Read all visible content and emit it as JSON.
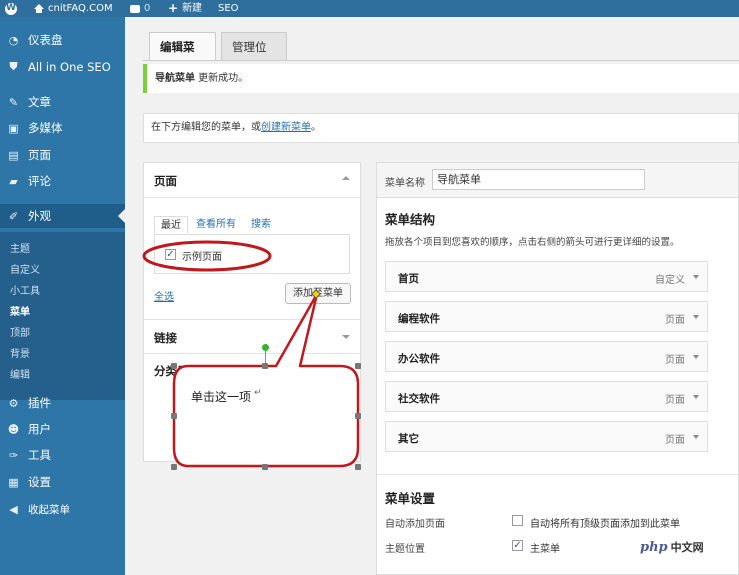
{
  "adminbar": {
    "site_name": "cnitFAQ.COM",
    "comments_count": "0",
    "new_label": "新建",
    "seo_label": "SEO"
  },
  "sidebar": {
    "items": [
      {
        "label": "仪表盘",
        "icon": "dashboard-icon"
      },
      {
        "label": "All in One SEO",
        "icon": "shield-icon"
      },
      {
        "label": "文章",
        "icon": "pin-icon"
      },
      {
        "label": "多媒体",
        "icon": "media-icon"
      },
      {
        "label": "页面",
        "icon": "page-icon"
      },
      {
        "label": "评论",
        "icon": "comment-icon"
      },
      {
        "label": "外观",
        "icon": "appearance-icon"
      },
      {
        "label": "插件",
        "icon": "plugin-icon"
      },
      {
        "label": "用户",
        "icon": "user-icon"
      },
      {
        "label": "工具",
        "icon": "wrench-icon"
      },
      {
        "label": "设置",
        "icon": "settings-icon"
      },
      {
        "label": "收起菜单",
        "icon": "collapse-icon"
      }
    ],
    "submenu": [
      "主题",
      "自定义",
      "小工具",
      "菜单",
      "顶部",
      "背景",
      "编辑"
    ],
    "current_sub": "菜单"
  },
  "tabs": {
    "edit": "编辑菜单",
    "manage": "管理位置"
  },
  "notice": {
    "strong": "导航菜单",
    "text": " 更新成功。"
  },
  "manage_box": {
    "prefix": "在下方编辑您的菜单，或",
    "link": "创建新菜单",
    "suffix": "。"
  },
  "left_panel": {
    "title": "页面",
    "subtabs": [
      "最近",
      "查看所有",
      "搜索"
    ],
    "page_item": "示例页面",
    "page_item_checked": true,
    "select_all": "全选",
    "add_button": "添加至菜单",
    "links_title": "链接",
    "categories_title": "分类目录"
  },
  "right_panel": {
    "name_label": "菜单名称",
    "name_value": "导航菜单",
    "structure_title": "菜单结构",
    "structure_hint": "拖放各个项目到您喜欢的顺序，点击右侧的箭头可进行更详细的设置。",
    "menu_items": [
      {
        "title": "首页",
        "type": "自定义"
      },
      {
        "title": "编程软件",
        "type": "页面"
      },
      {
        "title": "办公软件",
        "type": "页面"
      },
      {
        "title": "社交软件",
        "type": "页面"
      },
      {
        "title": "其它",
        "type": "页面"
      }
    ],
    "settings_title": "菜单设置",
    "auto_add_label": "自动添加页面",
    "auto_add_option": "自动将所有顶级页面添加到此菜单",
    "auto_add_checked": false,
    "location_label": "主题位置",
    "location_option": "主菜单",
    "location_checked": true
  },
  "annotation": {
    "callout_text": "单击这一项",
    "accent": "#c0181d"
  },
  "watermark": {
    "logo": "php",
    "text": "中文网"
  },
  "colors": {
    "sidebar": "#2e76a8",
    "adminbar": "#2e6f9e",
    "notice_border": "#7ad03a",
    "link": "#2271b1"
  }
}
